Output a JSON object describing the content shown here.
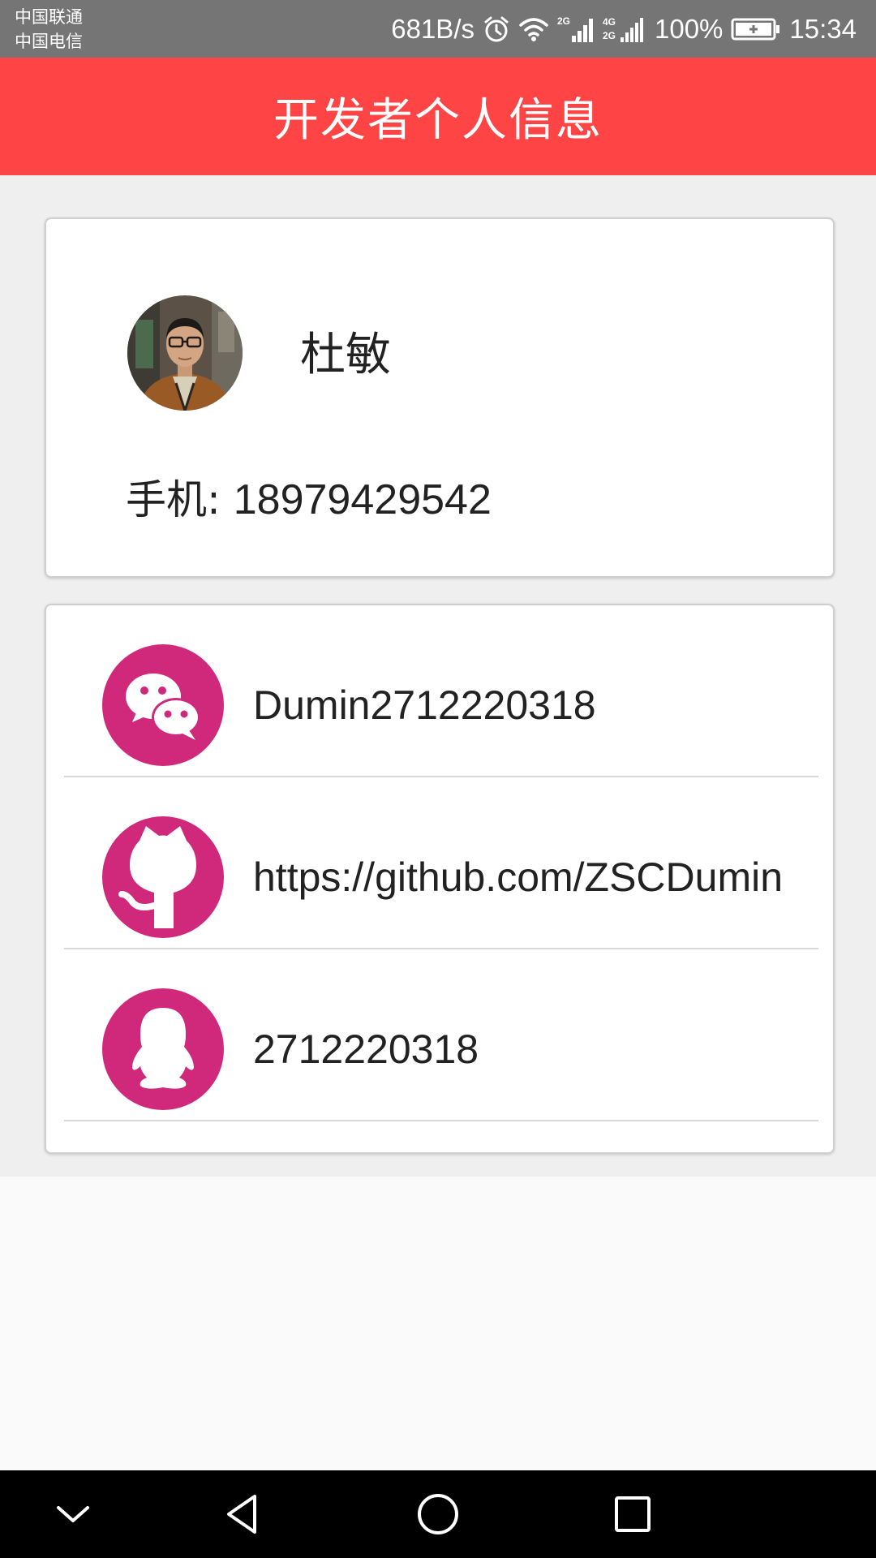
{
  "status_bar": {
    "carrier_1": "中国联通",
    "carrier_2": "中国电信",
    "net_speed": "681B/s",
    "network_2g": "2G",
    "network_4g": "4G",
    "network_4g_2": "2G",
    "battery": "100%",
    "time": "15:34"
  },
  "app_bar": {
    "title": "开发者个人信息"
  },
  "profile": {
    "name": "杜敏",
    "phone_label": "手机: ",
    "phone": "18979429542"
  },
  "contacts": [
    {
      "icon": "wechat-icon",
      "value": "Dumin2712220318"
    },
    {
      "icon": "github-icon",
      "value": "https://github.com/ZSCDumin"
    },
    {
      "icon": "qq-icon",
      "value": "2712220318"
    }
  ],
  "colors": {
    "app_bar": "#fe4444",
    "icon_circle": "#d0287a",
    "status_bar": "#757575",
    "page_bg": "#efefef"
  }
}
